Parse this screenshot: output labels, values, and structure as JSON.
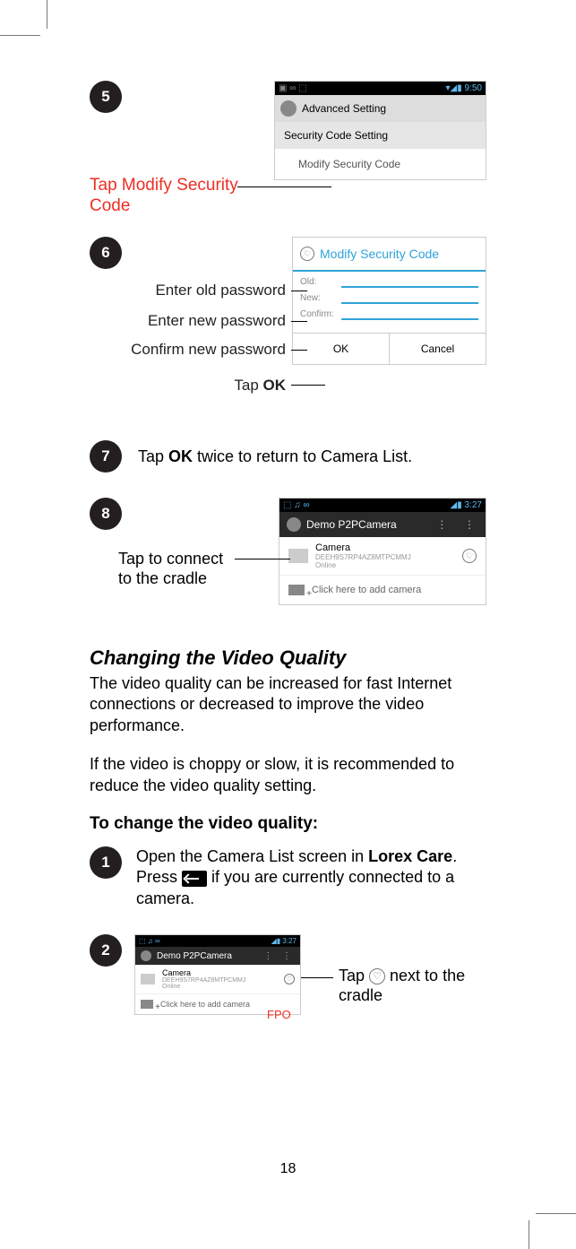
{
  "steps": {
    "s5": {
      "num": "5",
      "label": "Tap Modify Security\nCode"
    },
    "s6": {
      "num": "6",
      "l1": "Enter old password",
      "l2": "Enter new password",
      "l3": "Confirm new password",
      "l4_pre": "Tap ",
      "l4_b": "OK"
    },
    "s7": {
      "num": "7",
      "pre": "Tap ",
      "b": "OK",
      "post": " twice to return to Camera List."
    },
    "s8": {
      "num": "8",
      "label": "Tap to connect\nto the cradle"
    },
    "s1b": {
      "num": "1",
      "pre": "Open the Camera List screen in ",
      "b1": "Lorex Care",
      "mid": ". Press ",
      "post": " if you are currently connected to a camera."
    },
    "s2b": {
      "num": "2",
      "pre": "Tap ",
      "post": " next to the cradle"
    }
  },
  "shot1": {
    "time": "9:50",
    "hdr": "Advanced Setting",
    "sub": "Security Code Setting",
    "item": "Modify Security Code"
  },
  "shot2": {
    "title": "Modify Security Code",
    "old": "Old:",
    "new": "New:",
    "confirm": "Confirm:",
    "ok": "OK",
    "cancel": "Cancel"
  },
  "shot3": {
    "time": "3:27",
    "title": "Demo P2PCamera",
    "cam_name": "Camera",
    "cam_id": "DEEH9S7RP4AZ8MTPCMMJ",
    "cam_state": "Online",
    "add": "Click here to add camera"
  },
  "section": {
    "h2": "Changing the Video Quality",
    "p1": "The video quality can be increased for fast Internet connections or decreased to improve the video performance.",
    "p2": "If the video is choppy or slow, it is recommended to reduce the video quality setting.",
    "h3": "To change the video quality:"
  },
  "fpo": "FPO",
  "pagenum": "18"
}
